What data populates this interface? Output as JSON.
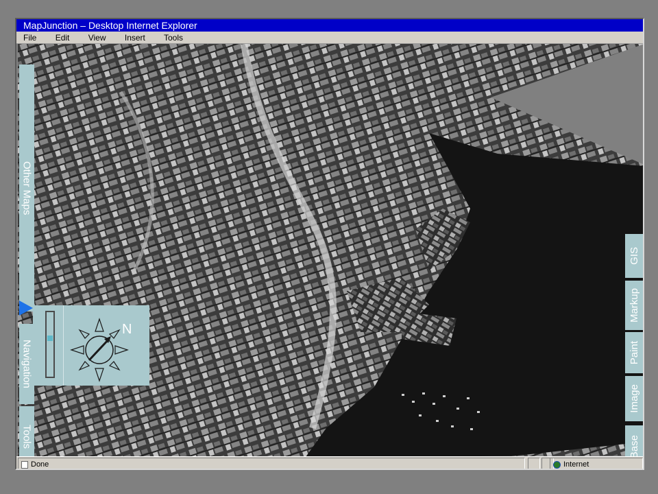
{
  "window": {
    "title": "MapJunction – Desktop  Internet Explorer"
  },
  "menu": {
    "items": [
      "File",
      "Edit",
      "View",
      "Insert",
      "Tools"
    ]
  },
  "left_tabs": {
    "other_maps": "Other Maps",
    "navigation": "Navigation",
    "tools": "Tools"
  },
  "right_tabs": {
    "gis": "GIS",
    "markup": "Markup",
    "paint": "Paint",
    "image": "Image",
    "base": "Base"
  },
  "compass": {
    "north_label": "N"
  },
  "zoom_slider": {
    "level": 0.38
  },
  "status": {
    "text": "Done",
    "zone": "Internet"
  },
  "colors": {
    "titlebar": "#0000c8",
    "tab": "#a9c9cd",
    "tab_text": "#ffffff",
    "arrow": "#1e73e8",
    "water": "#141414"
  }
}
